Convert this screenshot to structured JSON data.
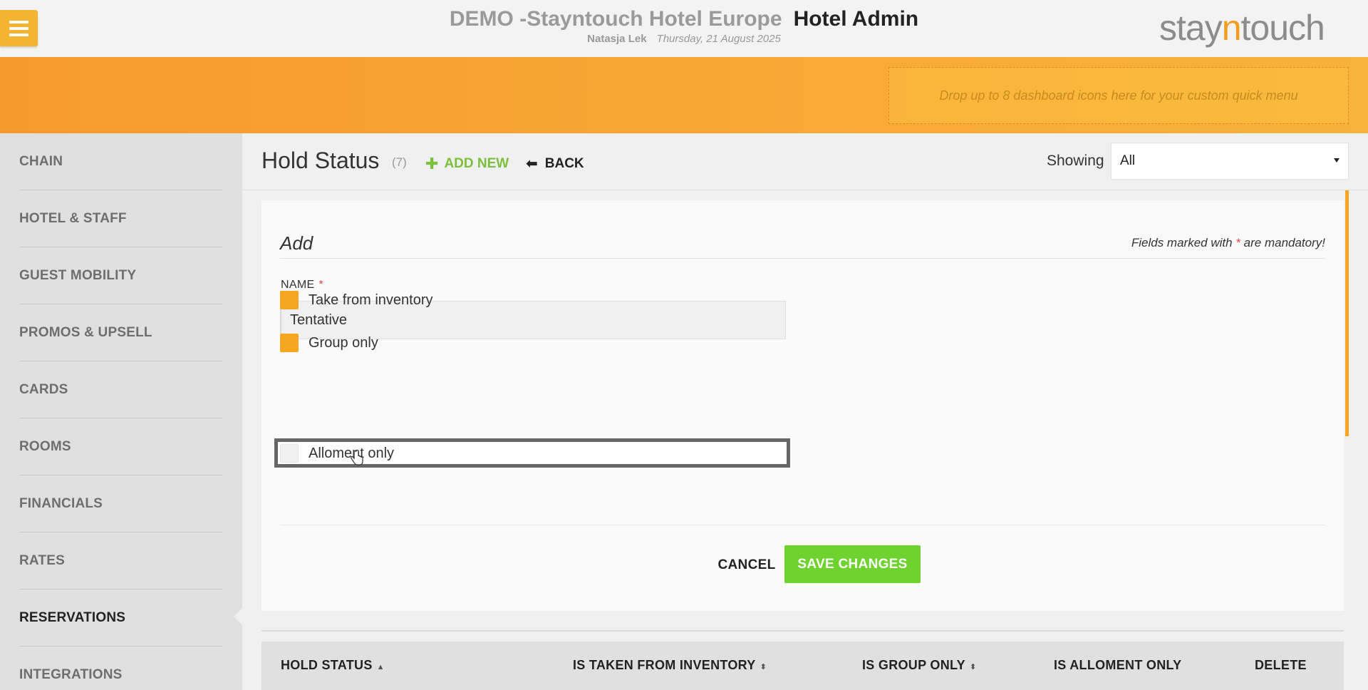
{
  "header": {
    "hotel_name": "DEMO -Stayntouch Hotel Europe",
    "app_name": "Hotel Admin",
    "user": "Natasja Lek",
    "date": "Thursday, 21 August 2025",
    "logo_prefix": "stay",
    "logo_n": "n",
    "logo_suffix": "touch"
  },
  "quick_menu": {
    "drop_text": "Drop up to 8 dashboard icons here for your custom quick menu"
  },
  "sidebar": {
    "items": [
      {
        "label": "CHAIN"
      },
      {
        "label": "HOTEL & STAFF"
      },
      {
        "label": "GUEST MOBILITY"
      },
      {
        "label": "PROMOS & UPSELL"
      },
      {
        "label": "CARDS"
      },
      {
        "label": "ROOMS"
      },
      {
        "label": "FINANCIALS"
      },
      {
        "label": "RATES"
      },
      {
        "label": "RESERVATIONS"
      },
      {
        "label": "INTEGRATIONS"
      }
    ],
    "active": "RESERVATIONS"
  },
  "page": {
    "title": "Hold Status",
    "count": "(7)",
    "add_new": "ADD NEW",
    "back": "BACK",
    "showing_label": "Showing",
    "showing_value": "All"
  },
  "form": {
    "title": "Add",
    "mandatory_prefix": "Fields marked with",
    "mandatory_star": "*",
    "mandatory_suffix": "are mandatory!",
    "name_label": "NAME",
    "name_required": "*",
    "name_value": "Tentative",
    "checkboxes": [
      {
        "label": "Take from inventory",
        "checked": true
      },
      {
        "label": "Group only",
        "checked": true
      },
      {
        "label": "Alloment only",
        "checked": false
      }
    ],
    "cancel": "CANCEL",
    "save": "SAVE CHANGES"
  },
  "table": {
    "columns": [
      {
        "label": "HOLD STATUS",
        "sort": "▲"
      },
      {
        "label": "IS TAKEN FROM INVENTORY",
        "sort": "⬍"
      },
      {
        "label": "IS GROUP ONLY",
        "sort": "⬍"
      },
      {
        "label": "IS ALLOMENT ONLY",
        "sort": ""
      },
      {
        "label": "DELETE",
        "sort": ""
      }
    ]
  },
  "colors": {
    "accent_orange": "#f6a621",
    "save_green": "#6fd22f",
    "add_green": "#7cbf3c"
  }
}
